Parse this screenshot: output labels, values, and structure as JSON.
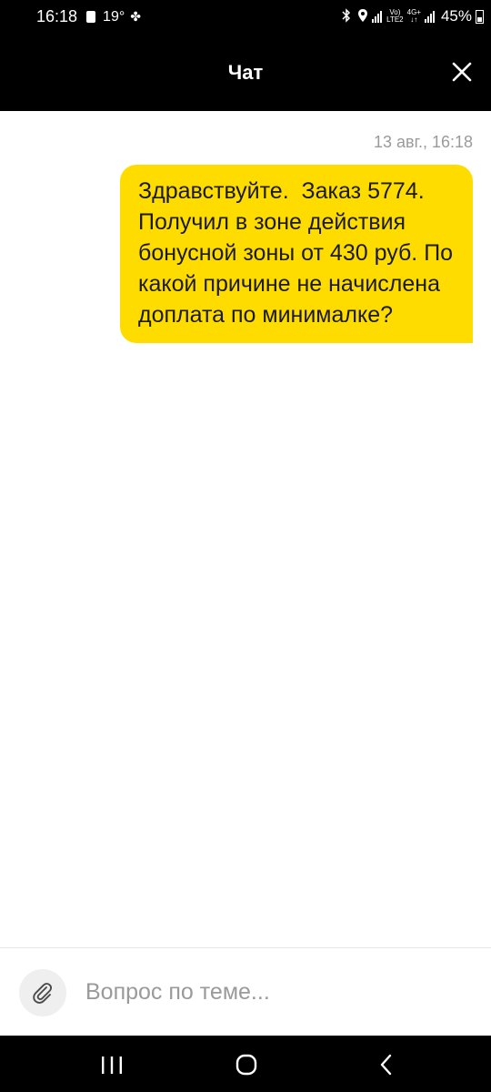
{
  "status_bar": {
    "time": "16:18",
    "temperature": "19°",
    "network_top": "Vo)",
    "network_bottom": "LTE2",
    "network_type": "4G+",
    "battery": "45%",
    "icons": [
      "notification-icon",
      "fan-icon",
      "bluetooth-icon",
      "location-icon",
      "signal-icon",
      "battery-icon"
    ]
  },
  "header": {
    "title": "Чат"
  },
  "messages": [
    {
      "timestamp": "13 авг., 16:18",
      "text": "Здравствуйте.  Заказ 5774. Получил в зоне действия бонусной зоны от 430 руб. По какой причине не начислена доплата по минималке?",
      "sender": "user"
    }
  ],
  "input": {
    "placeholder": "Вопрос по теме...",
    "value": ""
  },
  "colors": {
    "accent": "#ffdc00",
    "header_bg": "#000000",
    "muted_text": "#9a9a9a"
  }
}
